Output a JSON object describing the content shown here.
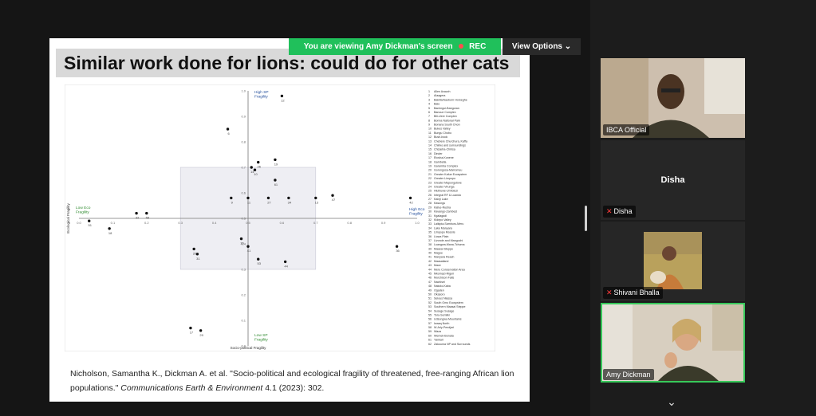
{
  "viewing_bar": {
    "text": "You are viewing  Amy Dickman's screen",
    "rec": "REC"
  },
  "view_options": {
    "label": "View Options"
  },
  "slide": {
    "title": "Similar work done for lions: could do for other cats",
    "citation_plain": "Nicholson, Samantha K., Dickman A. et al. \"Socio-political and ecological fragility of threatened, free-ranging African lion populations.\" ",
    "citation_journal": "Communications Earth & Environment",
    "citation_tail": " 4.1 (2023): 302."
  },
  "chart_data": {
    "type": "scatter",
    "xlabel": "Socio-political Fragility",
    "ylabel": "Ecological Fragility",
    "xlim": [
      0,
      1
    ],
    "ylim": [
      0,
      1
    ],
    "quadrant_labels": {
      "top": "High SP\nFragility",
      "bottom": "Low SP\nFragility",
      "left": "Low Eco\nFragility",
      "right": "High Eco\nFragility"
    },
    "x_ticks": [
      "0.0",
      "0.1",
      "0.2",
      "0.3",
      "0.4",
      "0.5",
      "0.6",
      "0.7",
      "0.8",
      "0.9",
      "1.0"
    ],
    "y_ticks": [
      "1.0",
      "0.9",
      "0.8",
      "0.7",
      "0.6",
      "0.5",
      "0.4",
      "0.3",
      "0.2",
      "0.1",
      "0.0"
    ],
    "points": [
      {
        "x": 0.6,
        "y": 0.98,
        "label": "12"
      },
      {
        "x": 0.44,
        "y": 0.85,
        "label": "6"
      },
      {
        "x": 0.58,
        "y": 0.73,
        "label": "19"
      },
      {
        "x": 0.53,
        "y": 0.72,
        "label": "26"
      },
      {
        "x": 0.51,
        "y": 0.7,
        "label": "14"
      },
      {
        "x": 0.52,
        "y": 0.69,
        "label": "10"
      },
      {
        "x": 0.58,
        "y": 0.65,
        "label": "61"
      },
      {
        "x": 0.45,
        "y": 0.58,
        "label": "9"
      },
      {
        "x": 0.5,
        "y": 0.58,
        "label": "11"
      },
      {
        "x": 0.56,
        "y": 0.58,
        "label": "27"
      },
      {
        "x": 0.62,
        "y": 0.58,
        "label": "34"
      },
      {
        "x": 0.7,
        "y": 0.58,
        "label": "13"
      },
      {
        "x": 0.75,
        "y": 0.59,
        "label": "47"
      },
      {
        "x": 0.98,
        "y": 0.58,
        "label": "42"
      },
      {
        "x": 0.03,
        "y": 0.49,
        "label": "51"
      },
      {
        "x": 0.09,
        "y": 0.46,
        "label": "18"
      },
      {
        "x": 0.17,
        "y": 0.52,
        "label": "32"
      },
      {
        "x": 0.2,
        "y": 0.52,
        "label": "58"
      },
      {
        "x": 0.48,
        "y": 0.42,
        "label": "15"
      },
      {
        "x": 0.5,
        "y": 0.39,
        "label": "41"
      },
      {
        "x": 0.53,
        "y": 0.34,
        "label": "53"
      },
      {
        "x": 0.61,
        "y": 0.33,
        "label": "44"
      },
      {
        "x": 0.34,
        "y": 0.38,
        "label": "20"
      },
      {
        "x": 0.35,
        "y": 0.36,
        "label": "31"
      },
      {
        "x": 0.94,
        "y": 0.39,
        "label": "36"
      },
      {
        "x": 0.33,
        "y": 0.07,
        "label": "17"
      },
      {
        "x": 0.36,
        "y": 0.06,
        "label": "29"
      }
    ],
    "legend_items": [
      "Allen Avazzh",
      "Alaagera",
      "Bakilla/Sauburn Horseghe",
      "Bale",
      "Bamingui-Bangoran",
      "Banoue Complex",
      "Bili-Uere Complex",
      "Bonna National Park",
      "Bonana South Onon",
      "Bukes Valley",
      "Bungu Chobo",
      "Bush-book",
      "Chebere Churchura, Kaffa",
      "Chinko and surroundings",
      "Chizarira-Chirisa",
      "Dinder",
      "Etosha-Kunene",
      "Gambella",
      "Garamba Complex",
      "Gorongosa-Marromeu",
      "Greater Kafue Ecosystem",
      "Greater Limpopo",
      "Greater Mapungubwe",
      "Greater Virunga",
      "Hluhluwe-Umfolozi",
      "Integral RF & Luando",
      "Kainji Lake",
      "Kasungu",
      "Kafue-Rusha",
      "Kavango-Zambezi",
      "Kgalagadi",
      "Kidepo Valley",
      "Laikipia-Samburu-Meru",
      "Lake Manyara",
      "Limpopo Mozete",
      "Liuwa Plain",
      "Livonde and Mangochi",
      "Luangwa-Mana-Tchuma",
      "Maasai Steppe",
      "Magoe",
      "Manyara Reach",
      "Maasailand",
      "Mace",
      "Meru Conservation Area",
      "Mkomazi-Rigeri",
      "Murchison Falls",
      "Nachisei",
      "Nakolo-Kaba",
      "Ogaden",
      "Okasoro",
      "Selous Niassa",
      "South Omo Ecosystem",
      "Southern Maasai Steppe",
      "Susage Susage",
      "Toro-Semliki",
      "Udzungwa Mountains",
      "Iwaaq North",
      "W-Arly-Pendjari",
      "Waza",
      "Wemek-Benata",
      "Yankari",
      "Zakouma NP and Surrounds"
    ]
  },
  "participants": [
    {
      "name": "IBCA Official",
      "muted": false,
      "type": "video"
    },
    {
      "name": "Disha",
      "display": "Disha",
      "muted": true,
      "type": "name"
    },
    {
      "name": "Shivani Bhalla",
      "muted": true,
      "type": "photo"
    },
    {
      "name": "Amy Dickman",
      "muted": false,
      "type": "video",
      "active": true
    }
  ]
}
